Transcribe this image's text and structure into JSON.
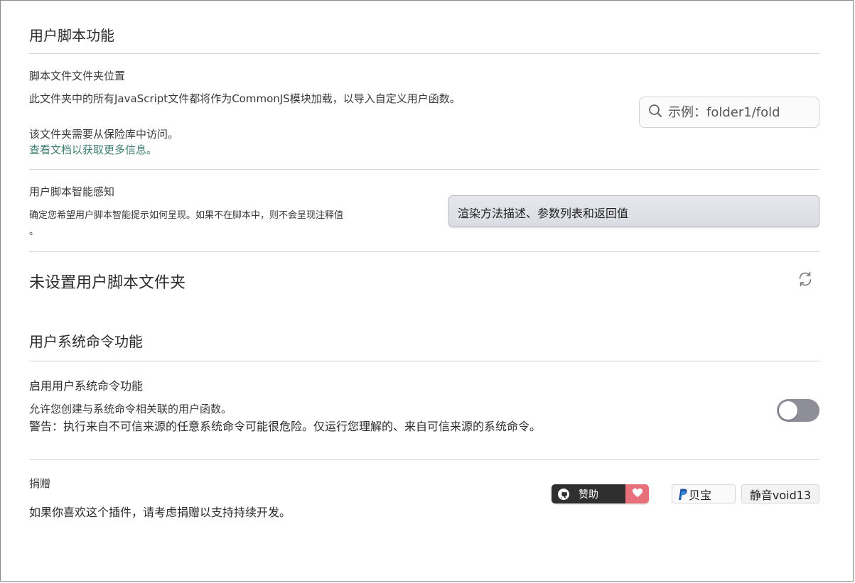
{
  "userscripts": {
    "heading": "用户脚本功能",
    "folder_label": "脚本文件文件夹位置",
    "folder_desc": "此文件夹中的所有JavaScript文件都将作为CommonJS模块加载，以导入自定义用户函数。",
    "folder_note": "该文件夹需要从保险库中访问。",
    "folder_link": "查看文档以获取更多信息。",
    "folder_placeholder": "示例：folder1/fold",
    "intellisense_label": "用户脚本智能感知",
    "intellisense_desc": "确定您希望用户脚本智能提示如何呈现。如果不在脚本中，则不会呈现注释值",
    "intellisense_desc_tail": "。",
    "intellisense_value": "渲染方法描述、参数列表和返回值",
    "not_set": "未设置用户脚本文件夹"
  },
  "syscmd": {
    "heading": "用户系统命令功能",
    "enable_label": "启用用户系统命令功能",
    "enable_desc": "允许您创建与系统命令相关联的用户函数。",
    "warning": "警告：执行来自不可信来源的任意系统命令可能很危险。仅运行您理解的、来自可信来源的系统命令。",
    "enabled": false
  },
  "donate": {
    "label": "捐赠",
    "desc": "如果你喜欢这个插件，请考虑捐赠以支持持续开发。",
    "sponsor_label": "赞助",
    "paypal_label": "贝宝",
    "coffee_label": "静音void13"
  },
  "icons": {
    "search": "search-icon",
    "refresh": "refresh-icon",
    "github": "github-icon",
    "heart": "heart-icon",
    "paypal": "paypal-icon"
  },
  "colors": {
    "link": "#3f7f6e",
    "toggle_off": "#8e8e98",
    "sponsor_dark": "#2f2f2f",
    "sponsor_heart": "#e8707a"
  }
}
